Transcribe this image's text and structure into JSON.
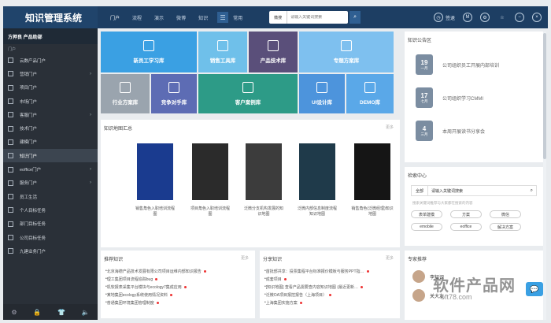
{
  "app": {
    "title": "知识管理系统"
  },
  "topnav": {
    "items": [
      "门户",
      "流程",
      "演示",
      "微博",
      "知识"
    ],
    "grid_label": "常用",
    "search_cat": "微搜",
    "search_placeholder": "请输入关键词搜索",
    "signin": "签退"
  },
  "sidebar": {
    "header": "方押良 产品助部",
    "sub": "门户",
    "items": [
      {
        "label": "云数产品门户"
      },
      {
        "label": "营销门户"
      },
      {
        "label": "项目门户"
      },
      {
        "label": "市场门户"
      },
      {
        "label": "客服门户"
      },
      {
        "label": "技术门户"
      },
      {
        "label": "建模门户"
      },
      {
        "label": "知识门户"
      },
      {
        "label": "eoffice门户"
      },
      {
        "label": "服务门户"
      },
      {
        "label": "员工生活"
      },
      {
        "label": "个人目标任务"
      },
      {
        "label": "部门目标任务"
      },
      {
        "label": "公司目标任务"
      },
      {
        "label": "九建业务门户"
      }
    ]
  },
  "tiles": [
    "新员工学习库",
    "销售工具库",
    "产品技术库",
    "专题方案库",
    "行业方案库",
    "竞争对手库",
    "客户案例库",
    "UI设计库",
    "DEMO库"
  ],
  "map": {
    "title": "知识地图汇总",
    "more": "更多",
    "books": [
      "销售角色入职培训流程图",
      "项目角色入职培训流程图",
      "泛微分支机构发展的知识地图",
      "泛微内部信息制度流程知识地图",
      "销售角色(泛微经理)知识地图"
    ]
  },
  "recommend": {
    "title": "推荐知识",
    "items": [
      "北京海德产品技术发展有限公司项目运维内部知识报告",
      "理工集团项目流程追踪bug",
      "机软报表采集平台模块与ecology7集成应用",
      "某地集团ecology系统使用情况资料",
      "普通集团环境集团管理制度"
    ]
  },
  "share": {
    "title": "分享知识",
    "items": [
      "首批部共享：投票集程平台标准报价模板与服务PPT指…",
      "成套项目",
      "[知识地图] 查看产品需要查内容知识地图 (最近更新…",
      "泛微OA项目报控报告（上海项目）",
      "上海集团实施方案"
    ]
  },
  "announce": {
    "title": "知识公告区",
    "items": [
      {
        "day": "19",
        "month": "一月",
        "text": "公司组织员工开展内部培训"
      },
      {
        "day": "17",
        "month": "七月",
        "text": "公司组织学习CMMI"
      },
      {
        "day": "4",
        "month": "三月",
        "text": "本周开展读书分享会"
      }
    ]
  },
  "search_center": {
    "title": "检索中心",
    "cat": "全部",
    "placeholder": "请输入关键词搜索",
    "hint": "搜索关键词推荐与大家都在搜索的内容",
    "tags": [
      "表单建模",
      "方案",
      "微信",
      "emobile",
      "eoffice",
      "解决方案"
    ]
  },
  "experts": {
    "title": "专家推荐",
    "names": [
      "李知识",
      "关大友"
    ]
  },
  "watermark": {
    "line1": "软件产品网",
    "line2": "oft78.com"
  }
}
